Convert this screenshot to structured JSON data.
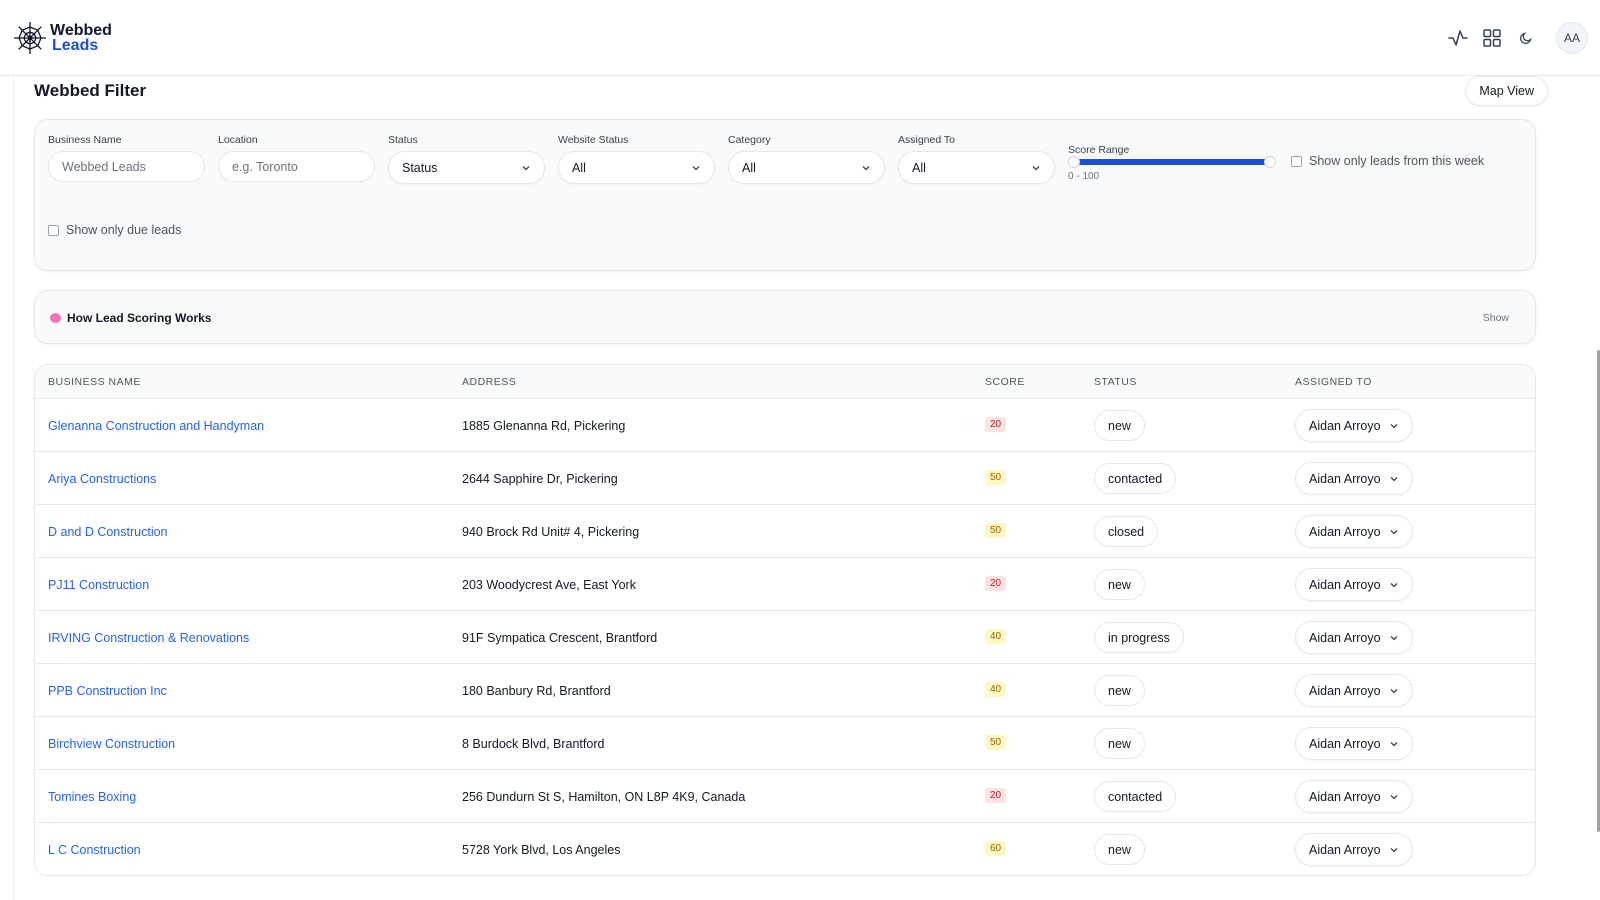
{
  "app": {
    "logo_line1": "Webbed",
    "logo_line2": "Leads",
    "avatar_initials": "AA"
  },
  "page": {
    "title": "Webbed Filter",
    "map_view_label": "Map View"
  },
  "filters": {
    "business_name": {
      "label": "Business Name",
      "placeholder": "Webbed Leads"
    },
    "location": {
      "label": "Location",
      "placeholder": "e.g. Toronto"
    },
    "status": {
      "label": "Status",
      "value": "Status"
    },
    "website_status": {
      "label": "Website Status",
      "value": "All"
    },
    "category": {
      "label": "Category",
      "value": "All"
    },
    "assigned_to": {
      "label": "Assigned To",
      "value": "All"
    },
    "score_range": {
      "label": "Score Range",
      "value_text": "0 - 100",
      "min": 0,
      "max": 100
    },
    "this_week_label": "Show only leads from this week",
    "due_leads_label": "Show only due leads"
  },
  "scoring": {
    "title": "How Lead Scoring Works",
    "toggle_label": "Show"
  },
  "table": {
    "headers": [
      "BUSINESS NAME",
      "ADDRESS",
      "SCORE",
      "STATUS",
      "ASSIGNED TO"
    ],
    "rows": [
      {
        "name": "Glenanna Construction and Handyman",
        "address": "1885 Glenanna Rd, Pickering",
        "score": "20",
        "status": "new",
        "assigned": "Aidan Arroyo"
      },
      {
        "name": "Ariya Constructions",
        "address": "2644 Sapphire Dr, Pickering",
        "score": "50",
        "status": "contacted",
        "assigned": "Aidan Arroyo"
      },
      {
        "name": "D and D Construction",
        "address": "940 Brock Rd Unit# 4, Pickering",
        "score": "50",
        "status": "closed",
        "assigned": "Aidan Arroyo"
      },
      {
        "name": "PJ11 Construction",
        "address": "203 Woodycrest Ave, East York",
        "score": "20",
        "status": "new",
        "assigned": "Aidan Arroyo"
      },
      {
        "name": "IRVING Construction & Renovations",
        "address": "91F Sympatica Crescent, Brantford",
        "score": "40",
        "status": "in progress",
        "assigned": "Aidan Arroyo"
      },
      {
        "name": "PPB Construction Inc",
        "address": "180 Banbury Rd, Brantford",
        "score": "40",
        "status": "new",
        "assigned": "Aidan Arroyo"
      },
      {
        "name": "Birchview Construction",
        "address": "8 Burdock Blvd, Brantford",
        "score": "50",
        "status": "new",
        "assigned": "Aidan Arroyo"
      },
      {
        "name": "Tomines Boxing",
        "address": "256 Dundurn St S, Hamilton, ON L8P 4K9, Canada",
        "score": "20",
        "status": "contacted",
        "assigned": "Aidan Arroyo"
      },
      {
        "name": "L C Construction",
        "address": "5728 York Blvd, Los Angeles",
        "score": "60",
        "status": "new",
        "assigned": "Aidan Arroyo"
      }
    ]
  },
  "score_colors": {
    "low": {
      "bg": "#fee2e2",
      "fg": "#b91c1c"
    },
    "mid": {
      "bg": "#fef9c3",
      "fg": "#a16207"
    }
  },
  "icons": [
    "spider-web-icon",
    "activity-icon",
    "grid-icon",
    "moon-icon",
    "chevron-down-icon",
    "brain-icon"
  ]
}
